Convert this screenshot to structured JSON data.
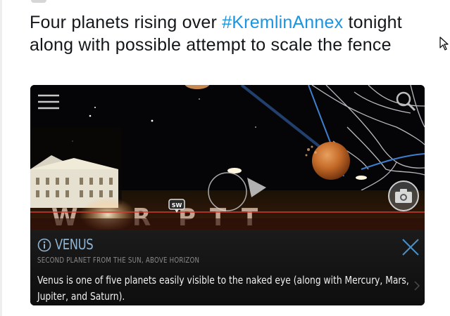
{
  "tweet": {
    "text_before": "Four planets rising over ",
    "hashtag": "#KremlinAnnex",
    "text_after": " tonight along with possible attempt to scale the fence"
  },
  "app": {
    "icons": {
      "menu": "hamburger-menu-icon",
      "search": "search-icon",
      "camera": "camera-icon",
      "compass_marker": "sw-marker-icon"
    },
    "compass_label": "SW",
    "info": {
      "title": "VENUS",
      "subtitle": "SECOND PLANET FROM THE SUN, ABOVE HORIZON",
      "description": "Venus is one of five planets easily visible to the naked eye (along with Mercury, Mars, Jupiter, and Saturn)."
    }
  },
  "colors": {
    "hashtag": "#1b95e0",
    "title_accent": "#8fb3d1",
    "close_icon": "#4a90c8",
    "horizon_line": "#d43a2f"
  }
}
